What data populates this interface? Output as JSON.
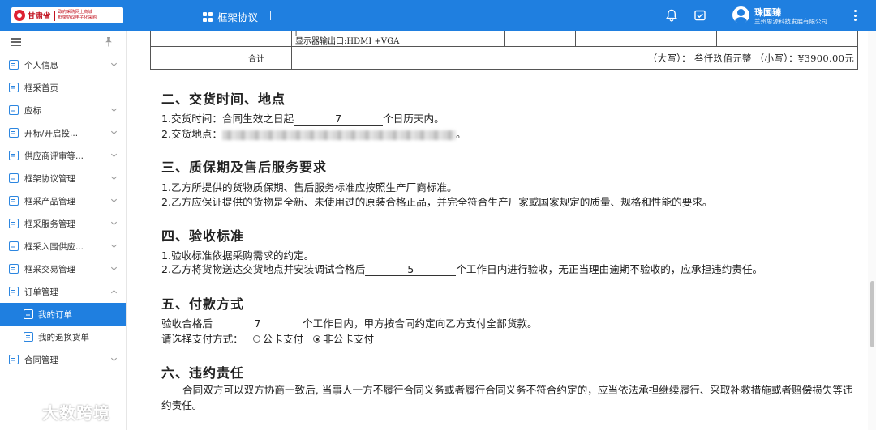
{
  "header": {
    "logo": {
      "name": "甘肃省",
      "line1": "政府采购网上商城",
      "line2": "框架协议电子化采购"
    },
    "nav_label": "框架协议",
    "nav_divider": "|",
    "user_name": "珠国臻",
    "user_org": "兰州思源科技发展有限公司",
    "icons": [
      "bell-icon",
      "inbox-check-icon",
      "user-avatar-icon",
      "more-vertical-icon"
    ]
  },
  "sidebar": {
    "items": [
      {
        "label": "个人信息",
        "expandable": true
      },
      {
        "label": "框采首页",
        "expandable": false
      },
      {
        "label": "应标",
        "expandable": true
      },
      {
        "label": "开标/开启投...",
        "expandable": true
      },
      {
        "label": "供应商评审等...",
        "expandable": true
      },
      {
        "label": "框架协议管理",
        "expandable": true
      },
      {
        "label": "框采产品管理",
        "expandable": true
      },
      {
        "label": "框采服务管理",
        "expandable": true
      },
      {
        "label": "框采入围供应...",
        "expandable": true
      },
      {
        "label": "框采交易管理",
        "expandable": true
      },
      {
        "label": "订单管理",
        "expandable": true,
        "expanded": true
      }
    ],
    "subitems": [
      {
        "label": "我的订单",
        "active": true
      },
      {
        "label": "我的退换货单",
        "active": false
      }
    ],
    "last_item": {
      "label": "合同管理",
      "expandable": true
    }
  },
  "table": {
    "row1_text": "显示器输出口:HDMI +VGA",
    "row1_mark": "[",
    "total_label": "合计",
    "total_value": "（大写）： 叁仟玖佰元整 （小写）：¥3900.00元"
  },
  "sections": {
    "s2": {
      "title": "二、交货时间、地点",
      "l1_pre": "1.交货时间：合同生效之日起",
      "l1_blank": "7",
      "l1_post": "个日历天内。",
      "l2_pre": "2.交货地点：",
      "l2_post": "。"
    },
    "s3": {
      "title": "三、质保期及售后服务要求",
      "l1": "1.乙方所提供的货物质保期、售后服务标准应按照生产厂商标准。",
      "l2": "2.乙方应保证提供的货物是全新、未使用过的原装合格正品，并完全符合生产厂家或国家规定的质量、规格和性能的要求。"
    },
    "s4": {
      "title": "四、验收标准",
      "l1": "1.验收标准依据采购需求的约定。",
      "l2_pre": "2.乙方将货物送达交货地点并安装调试合格后",
      "l2_blank": "5",
      "l2_post": "个工作日内进行验收，无正当理由逾期不验收的，应承担违约责任。"
    },
    "s5": {
      "title": "五、付款方式",
      "l1_pre": "验收合格后",
      "l1_blank": "7",
      "l1_post": "个工作日内，甲方按合同约定向乙方支付全部货款。",
      "l2_label": "请选择支付方式：",
      "option_a": "公卡支付",
      "option_b": "非公卡支付",
      "selected": "非公卡支付"
    },
    "s6": {
      "title": "六、违约责任",
      "body": "合同双方可以双方协商一致后, 当事人一方不履行合同义务或者履行合同义务不符合约定的，应当依法承担继续履行、采取补救措施或者赔偿损失等违约责任。"
    }
  },
  "watermark": "大数跨境",
  "colors": {
    "primary": "#1f7fe0",
    "logo_red": "#c1121f"
  }
}
